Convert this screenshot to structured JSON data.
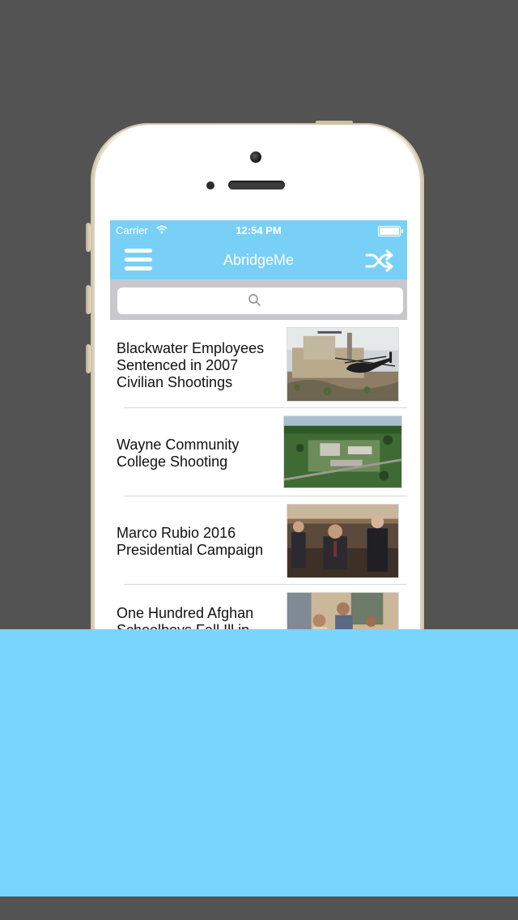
{
  "status_bar": {
    "carrier": "Carrier",
    "time": "12:54 PM"
  },
  "navbar": {
    "title": "AbridgeMe"
  },
  "search": {
    "placeholder": ""
  },
  "articles": [
    {
      "title": "Blackwater Employees Sentenced in 2007 Civilian Shootings"
    },
    {
      "title": "Wayne Community College Shooting"
    },
    {
      "title": "Marco Rubio 2016 Presidential Campaign"
    },
    {
      "title": "One Hundred Afghan Schoolboys Fall Ill in"
    }
  ],
  "colors": {
    "accent": "#79d0f6",
    "overlay": "#79d5fe",
    "background": "#535353"
  }
}
